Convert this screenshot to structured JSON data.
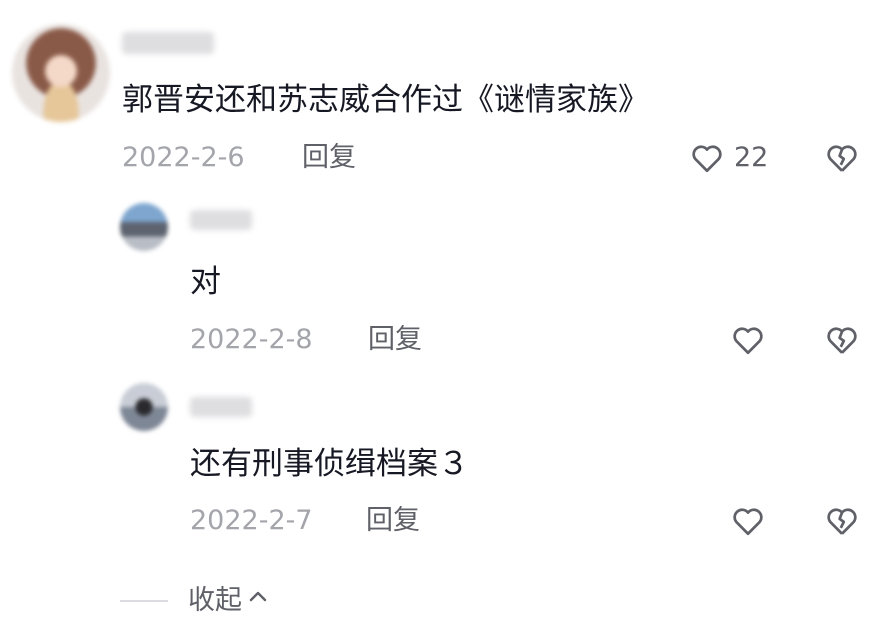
{
  "comments": {
    "main": {
      "text": "郭晋安还和苏志威合作过《谜情家族》",
      "date": "2022-2-6",
      "reply_label": "回复",
      "like_count": "22"
    },
    "replies": [
      {
        "text": "对",
        "date": "2022-2-8",
        "reply_label": "回复"
      },
      {
        "text": "还有刑事侦缉档案３",
        "date": "2022-2-7",
        "reply_label": "回复"
      }
    ]
  },
  "footer": {
    "collapse_label": "收起"
  },
  "icons": {
    "like": "heart-outline-icon",
    "dislike": "broken-heart-icon",
    "collapse": "chevron-up-icon"
  },
  "colors": {
    "text": "#161823",
    "meta": "#a4a5ab",
    "action": "#5f6068"
  }
}
